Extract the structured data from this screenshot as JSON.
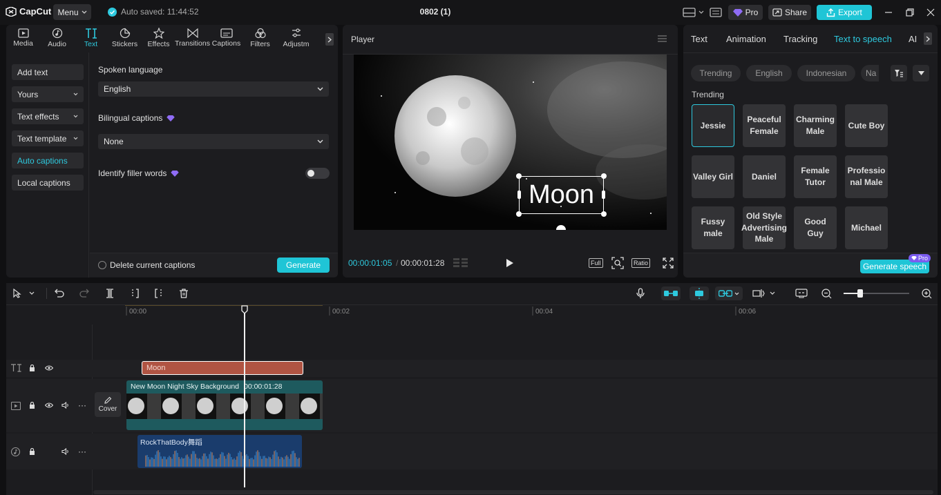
{
  "app": {
    "logo_text": "CapCut",
    "menu_label": "Menu",
    "autosave_text": "Auto saved: 11:44:52",
    "project_title": "0802 (1)",
    "pro_label": "Pro",
    "share_label": "Share",
    "export_label": "Export"
  },
  "tool_tabs": [
    {
      "label": "Media"
    },
    {
      "label": "Audio"
    },
    {
      "label": "Text"
    },
    {
      "label": "Stickers"
    },
    {
      "label": "Effects"
    },
    {
      "label": "Transitions"
    },
    {
      "label": "Captions"
    },
    {
      "label": "Filters"
    },
    {
      "label": "Adjustm"
    }
  ],
  "text_panel": {
    "side_items": [
      "Add text",
      "Yours",
      "Text effects",
      "Text template",
      "Auto captions",
      "Local captions"
    ],
    "spoken_language_label": "Spoken language",
    "spoken_language_value": "English",
    "bilingual_label": "Bilingual captions",
    "bilingual_value": "None",
    "filler_label": "Identify filler words",
    "delete_captions_label": "Delete current captions",
    "generate_label": "Generate"
  },
  "player": {
    "title": "Player",
    "overlay_text": "Moon",
    "time_current": "00:00:01:05",
    "time_total": "00:00:01:28",
    "full_label": "Full",
    "ratio_label": "Ratio"
  },
  "right_panel": {
    "tabs": [
      "Text",
      "Animation",
      "Tracking",
      "Text to speech",
      "AI"
    ],
    "filter_chips": [
      "Trending",
      "English",
      "Indonesian",
      "Na"
    ],
    "section_label": "Trending",
    "voices": [
      [
        "Jessie",
        "Peaceful\nFemale",
        "Charming\nMale",
        "Cute Boy"
      ],
      [
        "Valley Girl",
        "Daniel",
        "Female\nTutor",
        "Professio\nnal Male"
      ],
      [
        "Fussy\nmale",
        "Old Style\nAdvertising\nMale",
        "Good\nGuy",
        "Michael"
      ]
    ],
    "generate_speech_label": "Generate speech",
    "pro_badge": "Pro"
  },
  "timeline": {
    "ruler_labels": [
      "00:00",
      "00:02",
      "00:04",
      "00:06"
    ],
    "text_clip_label": "Moon",
    "video_clip_label": "New Moon Night Sky Background",
    "video_clip_duration": "00:00:01:28",
    "cover_label": "Cover",
    "audio_clip_label": "RockThatBody舞蹈"
  },
  "colors": {
    "accent": "#2ecadf",
    "text_clip": "#b05443",
    "video_clip": "#1e5a5e",
    "audio_clip": "#1a3c6c",
    "pro_badge": "#7b5cf0"
  }
}
